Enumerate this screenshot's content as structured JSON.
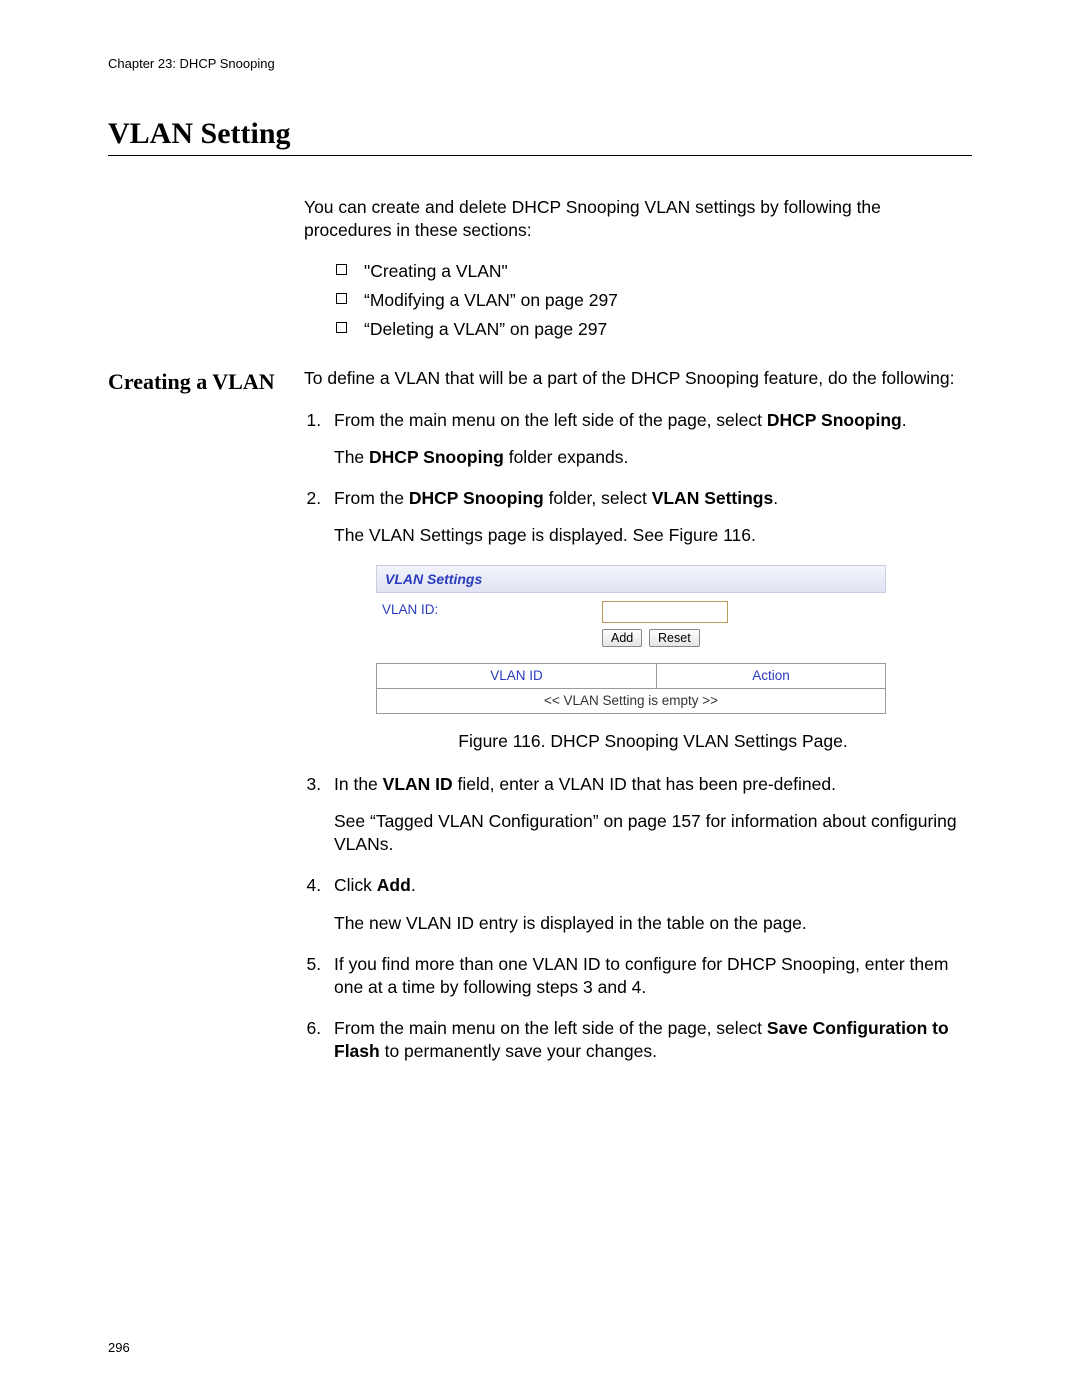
{
  "chapter_header": "Chapter 23: DHCP Snooping",
  "main_heading": "VLAN Setting",
  "intro": "You can create and delete DHCP Snooping VLAN settings by following the procedures in these sections:",
  "toc": [
    "\"Creating a VLAN\"",
    "“Modifying a VLAN” on page 297",
    "“Deleting a VLAN” on page 297"
  ],
  "side_heading": "Creating a VLAN",
  "creating_intro": "To define a VLAN that will be a part of the DHCP Snooping feature, do the following:",
  "step1_pre": "From the main menu on the left side of the page, select ",
  "step1_bold": "DHCP Snooping",
  "step1_post": ".",
  "step1_note_pre": "The ",
  "step1_note_bold": "DHCP Snooping",
  "step1_note_post": " folder expands.",
  "step2_pre": "From the ",
  "step2_b1": "DHCP Snooping",
  "step2_mid": " folder, select ",
  "step2_b2": "VLAN Settings",
  "step2_post": ".",
  "step2_note": "The VLAN Settings page is displayed. See Figure 116.",
  "panel": {
    "title": "VLAN Settings",
    "label": "VLAN ID:",
    "input_value": "",
    "add_btn": "Add",
    "reset_btn": "Reset",
    "th_vlanid": "VLAN ID",
    "th_action": "Action",
    "empty_row": "<< VLAN Setting is empty >>"
  },
  "figure_caption": "Figure 116. DHCP Snooping VLAN Settings Page.",
  "step3_pre": "In the ",
  "step3_bold": "VLAN ID",
  "step3_post": " field, enter a VLAN ID that has been pre-defined.",
  "step3_note": "See “Tagged VLAN Configuration” on page 157 for information about configuring VLANs.",
  "step4_pre": "Click ",
  "step4_bold": "Add",
  "step4_post": ".",
  "step4_note": "The new VLAN ID entry is displayed in the table on the page.",
  "step5": "If you find more than one VLAN ID to configure for DHCP Snooping, enter them one at a time by following steps 3 and 4.",
  "step6_pre": "From the main menu on the left side of the page, select ",
  "step6_bold": "Save Configuration to Flash",
  "step6_post": " to permanently save your changes.",
  "page_number": "296"
}
